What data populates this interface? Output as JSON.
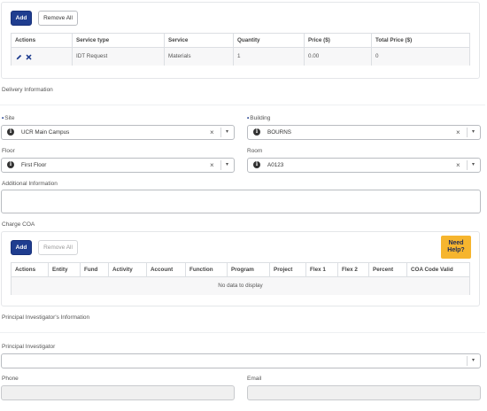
{
  "services": {
    "add_label": "Add",
    "remove_all_label": "Remove All",
    "columns": [
      "Actions",
      "Service type",
      "Service",
      "Quantity",
      "Price ($)",
      "Total Price ($)"
    ],
    "row": {
      "service_type": "IDT Request",
      "service": "Materials",
      "quantity": "1",
      "price": "0.00",
      "total_price": "0"
    }
  },
  "delivery": {
    "title": "Delivery Information",
    "site_label": "Site",
    "site_value": "UCR Main Campus",
    "building_label": "Building",
    "building_value": "BOURNS",
    "floor_label": "Floor",
    "floor_value": "First Floor",
    "room_label": "Room",
    "room_value": "A0123",
    "clear_glyph": "×",
    "caret_glyph": "▾",
    "info_glyph": "i"
  },
  "additional": {
    "label": "Additional Information",
    "value": ""
  },
  "coa": {
    "title": "Charge COA",
    "add_label": "Add",
    "remove_all_label": "Remove All",
    "columns": [
      "Actions",
      "Entity",
      "Fund",
      "Activity",
      "Account",
      "Function",
      "Program",
      "Project",
      "Flex 1",
      "Flex 2",
      "Percent",
      "COA Code Valid"
    ],
    "empty_text": "No data to display"
  },
  "help_button": {
    "line1": "Need",
    "line2": "Help?"
  },
  "pi": {
    "title": "Principal Investigator's Information",
    "pi_label": "Principal Investigator",
    "pi_value": "",
    "phone_label": "Phone",
    "phone_value": "",
    "email_label": "Email",
    "email_value": ""
  },
  "colors": {
    "primary": "#1f3d8f",
    "help": "#f6b52e"
  }
}
